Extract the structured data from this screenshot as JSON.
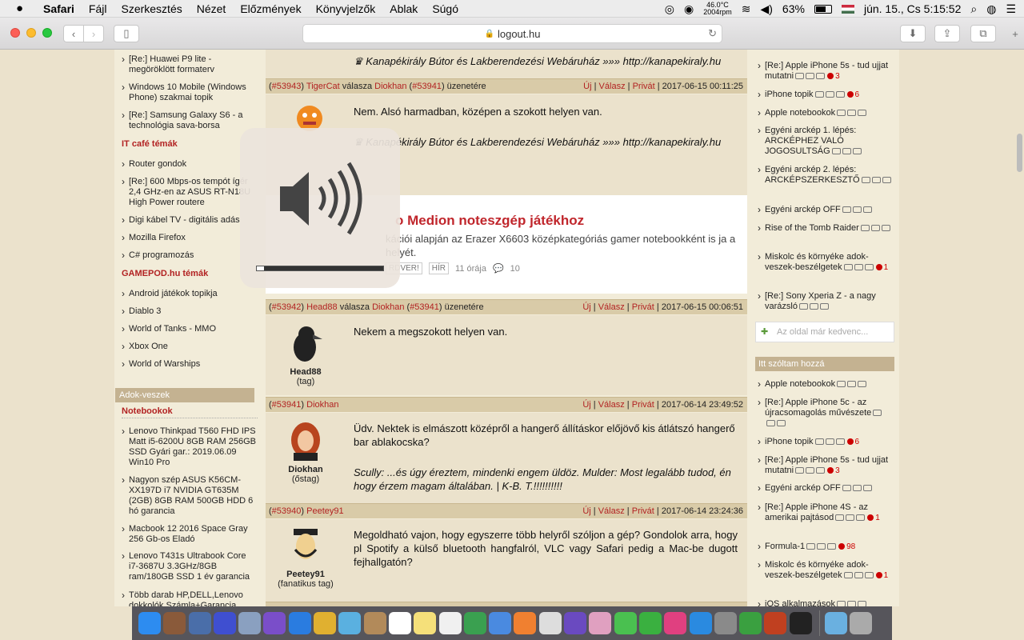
{
  "menubar": {
    "apple": "",
    "items": [
      "Safari",
      "Fájl",
      "Szerkesztés",
      "Nézet",
      "Előzmények",
      "Könyvjelzők",
      "Ablak",
      "Súgó"
    ],
    "temp_line1": "46.0°C",
    "temp_line2": "2004rpm",
    "battery": "63%",
    "datetime": "jún. 15., Cs  5:15:52"
  },
  "browser": {
    "url": "logout.hu"
  },
  "left": {
    "top_links": [
      "[Re:] Huawei P9 lite - megöröklött formaterv",
      "Windows 10 Mobile (Windows Phone) szakmai topik",
      "[Re:] Samsung Galaxy S6 - a technológia sava-borsa"
    ],
    "itcafe_title": "IT café témák",
    "itcafe_links": [
      "Router gondok",
      "[Re:] 600 Mbps-os tempót ígér 2,4 GHz-en az ASUS RT-N18U High Power routere",
      "Digi kábel TV - digitális adás",
      "Mozilla Firefox",
      "C# programozás"
    ],
    "gamepod_title": "GAMEPOD.hu témák",
    "gamepod_links": [
      "Android játékok topikja",
      "Diablo 3",
      "World of Tanks - MMO",
      "Xbox One",
      "World of Warships"
    ],
    "adok_title": "Adok-veszek",
    "notebook_title": "Notebookok",
    "notebook_links": [
      "Lenovo Thinkpad T560 FHD IPS Matt i5-6200U 8GB RAM 256GB SSD Gyári gar.: 2019.06.09 Win10 Pro",
      "Nagyon szép ASUS K56CM-XX197D i7 NVIDIA GT635M (2GB) 8GB RAM 500GB HDD 6 hó garancia",
      "Macbook 12 2016 Space Gray 256 Gb-os Eladó",
      "Lenovo T431s Ultrabook Core i7-3687U 3.3GHz/8GB ram/180GB SSD 1 év garancia",
      "Több darab HP,DELL,Lenovo dokkolók Számla+Garancia"
    ]
  },
  "posts": {
    "top_sig": "♛ Kanapékirály Bútor és Lakberendezési Webáruház »»» http://kanapekiraly.hu",
    "p1": {
      "num": "#53943",
      "author": "TigerCat",
      "reply_word": "válasza",
      "to": "Diokhan",
      "to_num": "#53941",
      "suffix": "üzenetére",
      "time": "2017-06-15 00:11:25",
      "text": "Nem. Alsó harmadban, középen a szokott helyen van.",
      "sig": "♛ Kanapékirály Bútor és Lakberendezési Webáruház »»» http://kanapekiraly.hu"
    },
    "p2": {
      "num": "#53942",
      "author": "Head88",
      "reply_word": "válasza",
      "to": "Diokhan",
      "to_num": "#53941",
      "suffix": "üzenetére",
      "time": "2017-06-15 00:06:51",
      "text": "Nekem a megszokott helyen van.",
      "name": "Head88",
      "rank": "(tag)"
    },
    "p3": {
      "num": "#53941",
      "author": "Diokhan",
      "time": "2017-06-14 23:49:52",
      "text": "Üdv. Nektek is elmászott középről a hangerő állításkor előjövő kis átlátszó hangerő bar ablakocska?",
      "sig": "Scully: ...és úgy éreztem, mindenki engem üldöz. Mulder: Most legalább tudod, én hogy érzem magam általában. | K-B. T.!!!!!!!!!!",
      "name": "Diokhan",
      "rank": "(őstag)"
    },
    "p4": {
      "num": "#53940",
      "author": "Peetey91",
      "time": "2017-06-14 23:24:36",
      "text": "Megoldható vajon, hogy egyszerre több helyről szóljon a gép? Gondolok arra, hogy pl Spotify a külső bluetooth hangfalról, VLC vagy Safari pedig a Mac-be dugott fejhallgatón?",
      "name": "Peetey91",
      "rank": "(fanatikus tag)"
    },
    "actions": {
      "new": "Új",
      "reply": "Válasz",
      "private": "Privát"
    }
  },
  "ad": {
    "title": "o Medion noteszgép játékhoz",
    "desc": "kációi alapján az Erazer X6603 középkategóriás gamer notebookként is ja a helyét.",
    "tag1": "RDVER!",
    "tag2": "HÍR",
    "age": "11 órája",
    "comments": "10"
  },
  "right": {
    "links1": [
      {
        "t": "[Re:] Apple iPhone 5s - tud ujjat mutatni",
        "c": "3"
      },
      {
        "t": "iPhone topik",
        "c": "6"
      },
      {
        "t": "Apple notebookok",
        "c": ""
      },
      {
        "t": "Egyéni arckép 1. lépés: ARCKÉPHEZ VALÓ JOGOSULTSÁG",
        "c": ""
      },
      {
        "t": "Egyéni arckép 2. lépés: ARCKÉPSZERKESZTŐ",
        "c": ""
      },
      {
        "t": "Egyéni arckép OFF",
        "c": ""
      },
      {
        "t": "Rise of the Tomb Raider",
        "c": ""
      },
      {
        "t": "Miskolc és környéke adok-veszek-beszélgetek",
        "c": "1"
      },
      {
        "t": "[Re:] Sony Xperia Z - a nagy varázsló",
        "c": ""
      }
    ],
    "fav_placeholder": "Az oldal már kedvenc...",
    "itt_title": "Itt szóltam hozzá",
    "links2": [
      {
        "t": "Apple notebookok",
        "c": ""
      },
      {
        "t": "[Re:] Apple iPhone 5c - az újracsomagolás művészete",
        "c": ""
      },
      {
        "t": "iPhone topik",
        "c": "6"
      },
      {
        "t": "[Re:] Apple iPhone 5s - tud ujjat mutatni",
        "c": "3"
      },
      {
        "t": "Egyéni arckép OFF",
        "c": ""
      },
      {
        "t": "[Re:] Apple iPhone 4S - az amerikai pajtásod",
        "c": "1"
      },
      {
        "t": "Formula-1",
        "c": "98"
      },
      {
        "t": "Miskolc és környéke adok-veszek-beszélgetek",
        "c": "1"
      },
      {
        "t": "iOS alkalmazások",
        "c": ""
      }
    ]
  },
  "hud": {
    "volume_fraction": 0.06
  },
  "dock": {
    "items": [
      "finder-icon",
      "photo-booth-icon",
      "mission-control-icon",
      "siri-icon",
      "launchpad-icon",
      "viber-icon",
      "safari-icon",
      "chrome-icon",
      "preview-icon",
      "contacts-icon",
      "calendar-icon",
      "notes-icon",
      "reminders-icon",
      "numbers-icon",
      "keynote-icon",
      "pages-icon",
      "textedit-icon",
      "imovie-icon",
      "photos-icon",
      "messages-icon",
      "facetime-icon",
      "itunes-icon",
      "app-store-icon",
      "system-preferences-icon",
      "utorrent-icon",
      "flash-icon",
      "terminal-icon",
      "downloads-folder-icon",
      "trash-icon"
    ],
    "colors": [
      "#2d8cf0",
      "#8a5a3a",
      "#4a6ea9",
      "#3f4fd0",
      "#8aa0c0",
      "#7a4ec9",
      "#2a7ce0",
      "#e0b030",
      "#5ab0e0",
      "#b28a5a",
      "#ffffff",
      "#f5e07a",
      "#f0f0f0",
      "#3aa050",
      "#4a8ae0",
      "#f08030",
      "#ddd",
      "#6a4ac0",
      "#e0a0c0",
      "#4ac050",
      "#3ab040",
      "#e04080",
      "#2a8ae0",
      "#8a8a8a",
      "#3aa040",
      "#c04020",
      "#222222",
      "#6ab0e0",
      "#aaaaaa"
    ]
  }
}
